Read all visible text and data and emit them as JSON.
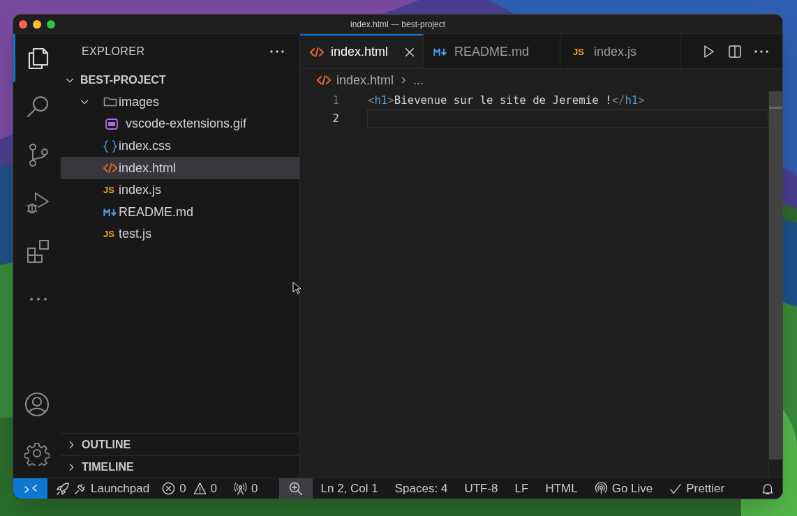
{
  "window": {
    "title": "index.html — best-project"
  },
  "activity_bar": {
    "items": [
      {
        "kind": "files",
        "selected": true
      },
      {
        "kind": "search",
        "selected": false
      },
      {
        "kind": "source-control",
        "selected": false
      },
      {
        "kind": "run-debug",
        "selected": false
      },
      {
        "kind": "extensions",
        "selected": false
      },
      {
        "kind": "more",
        "selected": false
      }
    ],
    "bottom": [
      {
        "kind": "account"
      },
      {
        "kind": "settings"
      }
    ]
  },
  "sidebar": {
    "title": "EXPLORER",
    "tree": {
      "label": "BEST-PROJECT",
      "expanded": true,
      "children": [
        {
          "label": "images",
          "kind": "folder",
          "expanded": true,
          "selected": false,
          "children": [
            {
              "label": "vscode-extensions.gif",
              "kind": "gif",
              "selected": false
            }
          ]
        },
        {
          "label": "index.css",
          "kind": "css",
          "selected": false
        },
        {
          "label": "index.html",
          "kind": "html",
          "selected": true
        },
        {
          "label": "index.js",
          "kind": "js",
          "icon_text": "JS",
          "selected": false
        },
        {
          "label": "README.md",
          "kind": "md",
          "selected": false
        },
        {
          "label": "test.js",
          "kind": "js",
          "icon_text": "JS",
          "selected": false
        }
      ]
    },
    "sections": [
      {
        "label": "OUTLINE",
        "expanded": false
      },
      {
        "label": "TIMELINE",
        "expanded": false
      }
    ]
  },
  "tabs": [
    {
      "label": "index.html",
      "kind": "html",
      "selected": true
    },
    {
      "label": "README.md",
      "kind": "md",
      "selected": false
    },
    {
      "label": "index.js",
      "kind": "js",
      "icon_text": "JS",
      "selected": false
    }
  ],
  "breadcrumb": {
    "file": "index.html",
    "kind": "html",
    "trail": "..."
  },
  "editor": {
    "lines": [
      {
        "number": "1",
        "current": false,
        "tokens": [
          {
            "kind": "punct",
            "text": "<"
          },
          {
            "kind": "tag",
            "text": "h1"
          },
          {
            "kind": "punct",
            "text": ">"
          },
          {
            "kind": "text",
            "text": "Bievenue sur le site de Jeremie !"
          },
          {
            "kind": "punct",
            "text": "</"
          },
          {
            "kind": "tag",
            "text": "h1"
          },
          {
            "kind": "punct",
            "text": ">"
          }
        ]
      },
      {
        "number": "2",
        "current": true
      }
    ]
  },
  "status_bar": [
    {
      "kind": "remote"
    },
    {
      "kind": "launchpad",
      "label": "Launchpad"
    },
    {
      "kind": "problems",
      "errors": "0",
      "warnings": "0"
    },
    {
      "kind": "ports",
      "label": "0"
    },
    {
      "kind": "zoom",
      "selected": true
    },
    {
      "kind": "text",
      "label": "Ln 2, Col 1"
    },
    {
      "kind": "text",
      "label": "Spaces: 4"
    },
    {
      "kind": "text",
      "label": "UTF-8"
    },
    {
      "kind": "text",
      "label": "LF"
    },
    {
      "kind": "text",
      "label": "HTML"
    },
    {
      "kind": "golive",
      "label": "Go Live"
    },
    {
      "kind": "prettier",
      "label": "Prettier"
    },
    {
      "kind": "bell"
    }
  ]
}
